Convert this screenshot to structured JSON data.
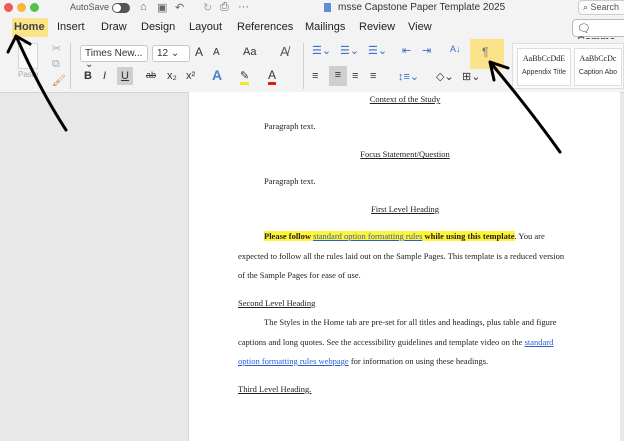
{
  "titlebar": {
    "autosave": "AutoSave",
    "title": "msse Capstone Paper  Template 2025",
    "search": "Search",
    "more": "···"
  },
  "tabs": [
    "Home",
    "Insert",
    "Draw",
    "Design",
    "Layout",
    "References",
    "Mailings",
    "Review",
    "View"
  ],
  "comments": "Comme",
  "ribbon": {
    "paste": "Paste",
    "font": "Times New...",
    "size": "12",
    "bold": "B",
    "italic": "I",
    "underline": "U",
    "sub": "x₂",
    "sup": "x²",
    "aa": "Aa",
    "grow": "A",
    "shrink": "A",
    "pilcrow": "¶",
    "sort": "A↓",
    "styles": [
      {
        "sample": "AaBbCcDdE",
        "name": "Appendix Title"
      },
      {
        "sample": "AaBbCcDc",
        "name": "Caption Abo"
      }
    ]
  },
  "doc": {
    "h1": "Context of the Study",
    "p1": "Paragraph text.",
    "h2": "Focus Statement/Question",
    "p2": "Paragraph text.",
    "h3": "First Level Heading",
    "para_a": "Please follow ",
    "para_link": "standard option formatting rules",
    "para_b": " while using this template",
    "para_c": ". You are",
    "line2": "expected to follow all the rules laid out on the Sample Pages. This template is a reduced version",
    "line3": "of the Sample Pages for ease of use.",
    "h4": "Second Level Heading",
    "s1": "The Styles in the Home tab are pre-set for all titles and headings, plus table and figure",
    "s2": "captions and long quotes. See the accessibility guidelines and template video on the ",
    "s2_link": "standard",
    "s3_link": "option formatting rules webpage",
    "s3": " for information on using these headings.",
    "h5": "Third Level Heading."
  },
  "colors": {
    "highlight": "#fff536",
    "tab_highlight": "#fbe38a",
    "link": "#2a5bd7"
  }
}
